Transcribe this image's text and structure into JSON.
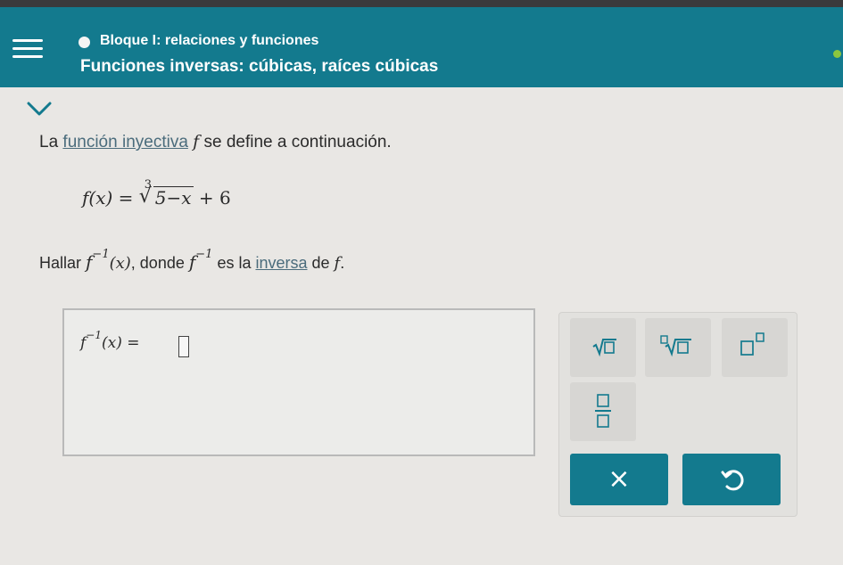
{
  "header": {
    "topic": "Bloque I: relaciones y funciones",
    "title": "Funciones inversas: cúbicas, raíces cúbicas"
  },
  "problem": {
    "intro_pre": "La ",
    "intro_link": "función inyectiva",
    "intro_var": "f",
    "intro_post": " se define a continuación.",
    "formula_lhs": "f(x) = ",
    "formula_index": "3",
    "formula_radicand": "5−x",
    "formula_tail": " + 6",
    "question_pre": "Hallar ",
    "question_fn": "f",
    "question_sup": "−1",
    "question_arg": "(x)",
    "question_mid": ", donde ",
    "question_fn2": "f",
    "question_sup2": "−1",
    "question_post": " es la ",
    "question_link": "inversa",
    "question_de": " de ",
    "question_var": "f",
    "question_dot": "."
  },
  "answer": {
    "label_fn": "f",
    "label_sup": "−1",
    "label_rest": "(x) =",
    "value": ""
  },
  "keypad": {
    "keys": [
      "square-root",
      "nth-root",
      "exponent",
      "fraction"
    ],
    "clear_label": "×"
  },
  "colors": {
    "header": "#137a8e",
    "button": "#137a8e",
    "status": "#8cc63f"
  }
}
